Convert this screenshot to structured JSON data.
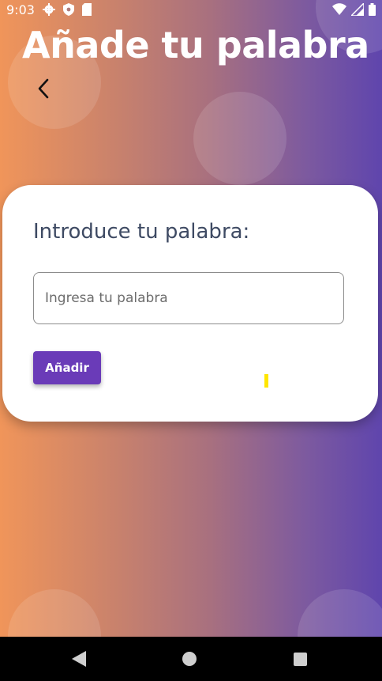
{
  "status_bar": {
    "time": "9:03",
    "left_icons": [
      "settings-icon",
      "shield-icon",
      "sd-card-icon"
    ],
    "right_icons": [
      "wifi-icon",
      "signal-icon",
      "battery-icon"
    ]
  },
  "header": {
    "title": "Añade tu palabra",
    "back_icon": "arrow-back-icon"
  },
  "card": {
    "heading": "Introduce tu palabra:",
    "input": {
      "value": "",
      "placeholder": "Ingresa tu palabra"
    },
    "add_button_label": "Añadir"
  },
  "nav_bar": {
    "buttons": [
      "back-triangle-icon",
      "home-circle-icon",
      "recents-square-icon"
    ]
  },
  "colors": {
    "gradient_start": "#f0955a",
    "gradient_end": "#5f45ad",
    "button": "#6a3bb8",
    "heading_text": "#3e4a63"
  }
}
